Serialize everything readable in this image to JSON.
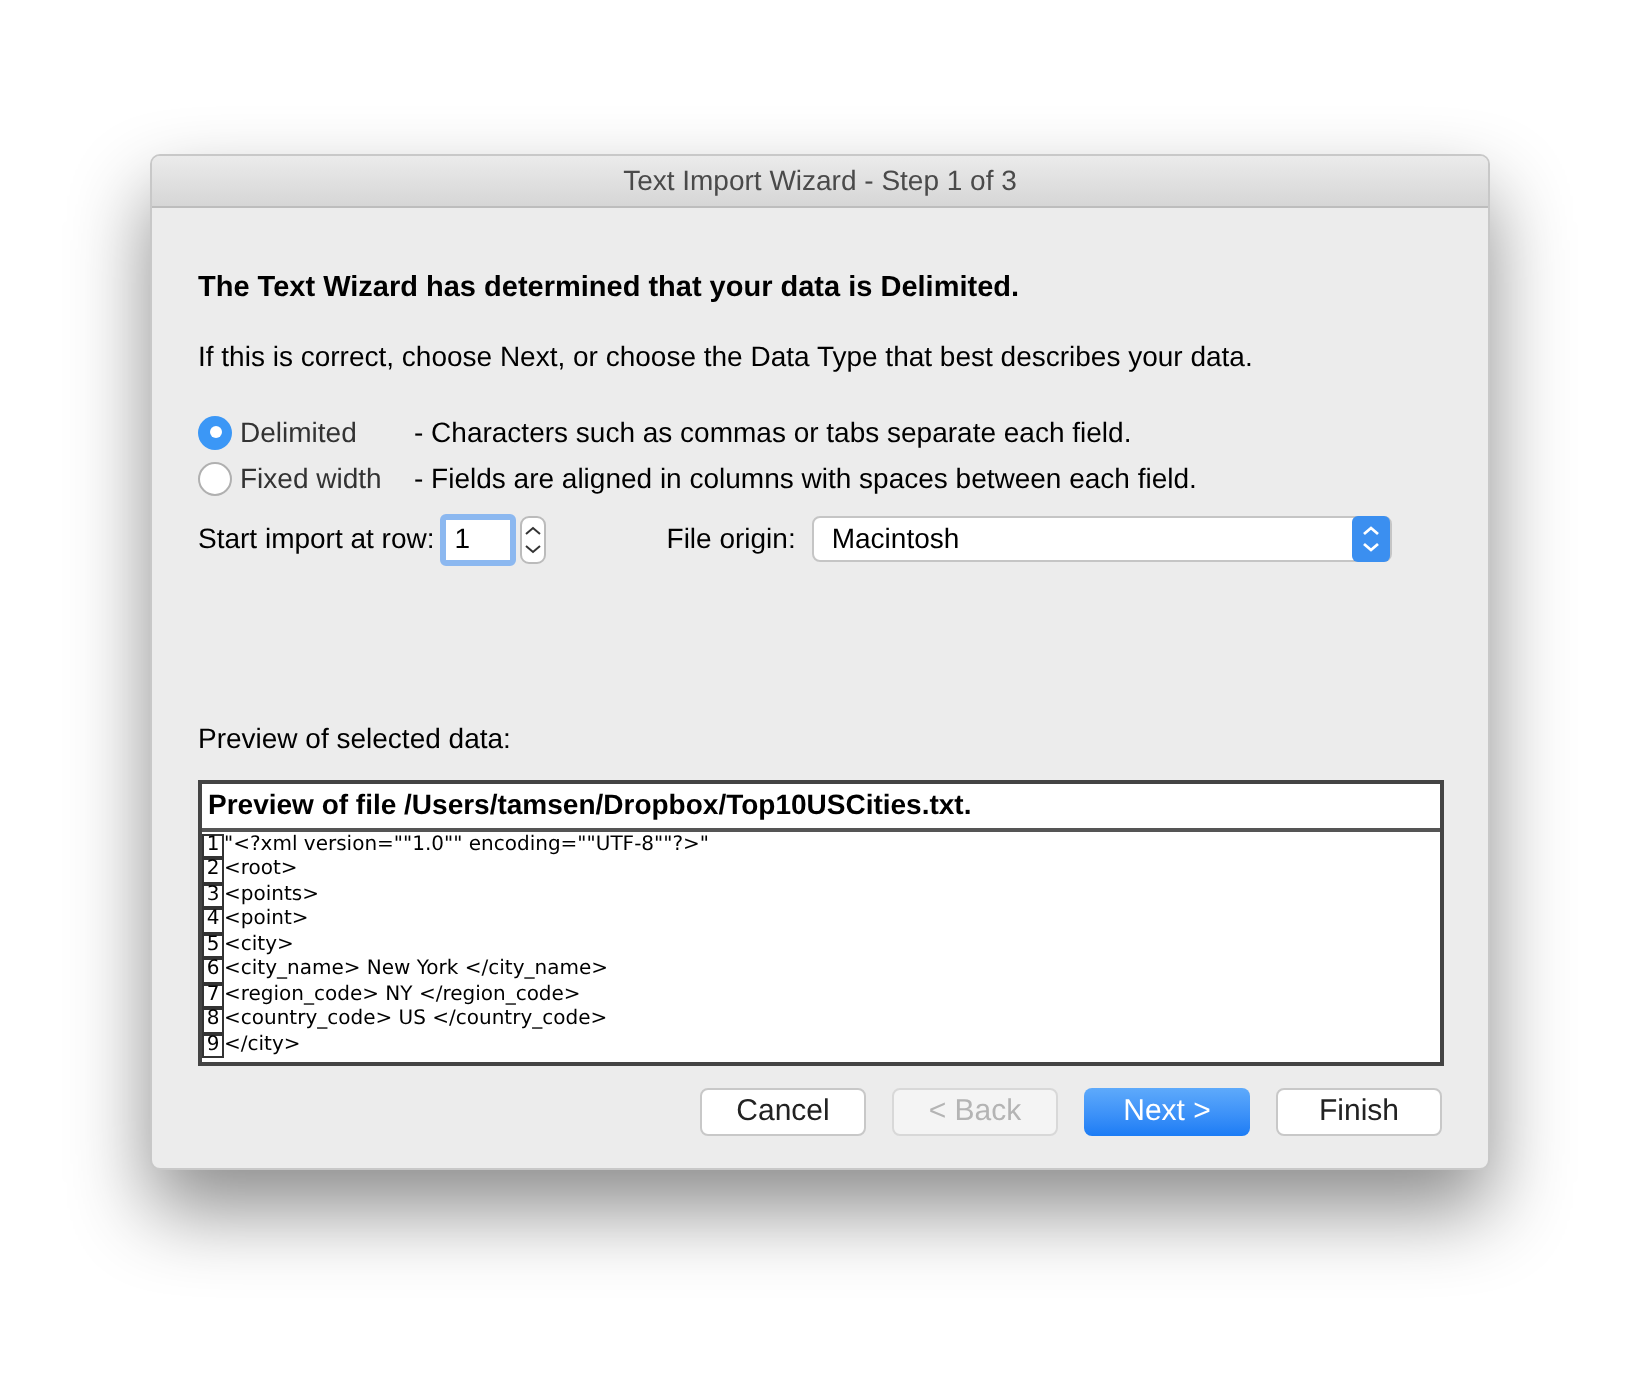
{
  "window": {
    "title": "Text Import Wizard - Step 1 of 3"
  },
  "heading": "The Text Wizard has determined that your data is Delimited.",
  "instruction": "If this is correct, choose Next, or choose the Data Type that best describes your data.",
  "data_types": [
    {
      "label": "Delimited",
      "description": "- Characters such as commas or tabs separate each field.",
      "selected": true
    },
    {
      "label": "Fixed width",
      "description": "- Fields are aligned in columns with spaces between each field.",
      "selected": false
    }
  ],
  "start_row": {
    "label": "Start import at row:",
    "value": "1"
  },
  "file_origin": {
    "label": "File origin:",
    "value": "Macintosh"
  },
  "preview": {
    "label": "Preview of selected data:",
    "title": "Preview of file /Users/tamsen/Dropbox/Top10USCities.txt.",
    "lines": [
      {
        "number": "1",
        "text": "\"<?xml version=\"\"1.0\"\" encoding=\"\"UTF-8\"\"?>\""
      },
      {
        "number": "2",
        "text": "<root>"
      },
      {
        "number": "3",
        "text": "<points>"
      },
      {
        "number": "4",
        "text": "<point>"
      },
      {
        "number": "5",
        "text": "<city>"
      },
      {
        "number": "6",
        "text": "<city_name> New York </city_name>"
      },
      {
        "number": "7",
        "text": "<region_code> NY </region_code>"
      },
      {
        "number": "8",
        "text": "<country_code> US </country_code>"
      },
      {
        "number": "9",
        "text": "</city>"
      }
    ]
  },
  "buttons": [
    {
      "label": "Cancel",
      "kind": "default",
      "disabled": false
    },
    {
      "label": "< Back",
      "kind": "default",
      "disabled": true
    },
    {
      "label": "Next >",
      "kind": "primary",
      "disabled": false
    },
    {
      "label": "Finish",
      "kind": "default",
      "disabled": false
    }
  ]
}
